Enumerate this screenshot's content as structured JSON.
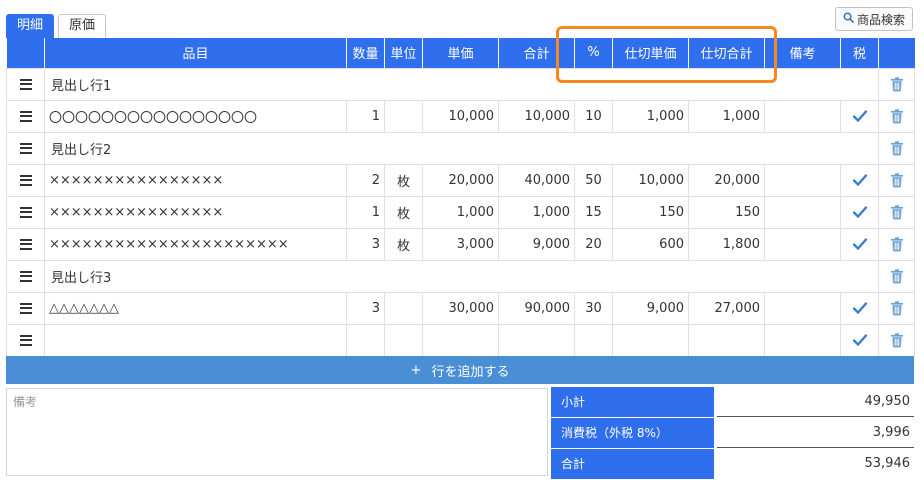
{
  "tabs": [
    {
      "label": "明細",
      "active": true
    },
    {
      "label": "原価",
      "active": false
    }
  ],
  "search_button": {
    "label": "商品検索",
    "icon": "search-icon"
  },
  "columns": {
    "item": "品目",
    "qty": "数量",
    "unit": "単位",
    "price": "単価",
    "amount": "合計",
    "pct": "%",
    "cost_price": "仕切単価",
    "cost_total": "仕切合計",
    "remarks": "備考",
    "tax": "税"
  },
  "rows": [
    {
      "type": "heading",
      "label": "見出し行1"
    },
    {
      "type": "item",
      "item": "〇〇〇〇〇〇〇〇〇〇〇〇〇〇〇〇",
      "qty": "1",
      "unit": "",
      "price": "10,000",
      "amount": "10,000",
      "pct": "10",
      "cost_price": "1,000",
      "cost_total": "1,000",
      "remarks": "",
      "taxed": true
    },
    {
      "type": "heading",
      "label": "見出し行2"
    },
    {
      "type": "item",
      "item": "××××××××××××××××",
      "qty": "2",
      "unit": "枚",
      "price": "20,000",
      "amount": "40,000",
      "pct": "50",
      "cost_price": "10,000",
      "cost_total": "20,000",
      "remarks": "",
      "taxed": true
    },
    {
      "type": "item",
      "item": "××××××××××××××××",
      "qty": "1",
      "unit": "枚",
      "price": "1,000",
      "amount": "1,000",
      "pct": "15",
      "cost_price": "150",
      "cost_total": "150",
      "remarks": "",
      "taxed": true
    },
    {
      "type": "item",
      "item": "××××××××××××××××××××××",
      "qty": "3",
      "unit": "枚",
      "price": "3,000",
      "amount": "9,000",
      "pct": "20",
      "cost_price": "600",
      "cost_total": "1,800",
      "remarks": "",
      "taxed": true
    },
    {
      "type": "heading",
      "label": "見出し行3"
    },
    {
      "type": "item",
      "item": "△△△△△△△",
      "qty": "3",
      "unit": "",
      "price": "30,000",
      "amount": "90,000",
      "pct": "30",
      "cost_price": "9,000",
      "cost_total": "27,000",
      "remarks": "",
      "taxed": true
    },
    {
      "type": "item",
      "item": "",
      "qty": "",
      "unit": "",
      "price": "",
      "amount": "",
      "pct": "",
      "cost_price": "",
      "cost_total": "",
      "remarks": "",
      "taxed": true
    }
  ],
  "add_row": {
    "icon": "+",
    "label": "行を追加する"
  },
  "notes": {
    "placeholder": "備考",
    "value": ""
  },
  "summary": {
    "subtotal_label": "小計",
    "subtotal_value": "49,950",
    "tax_label": "消費税（外税 8%）",
    "tax_value": "3,996",
    "total_label": "合計",
    "total_value": "53,946"
  },
  "colors": {
    "header_blue": "#2f6fee",
    "add_row_blue": "#4a8fd6",
    "highlight_orange": "#f5891f",
    "check_blue": "#3a7bd5",
    "trash_blue": "#6a9ed6"
  }
}
